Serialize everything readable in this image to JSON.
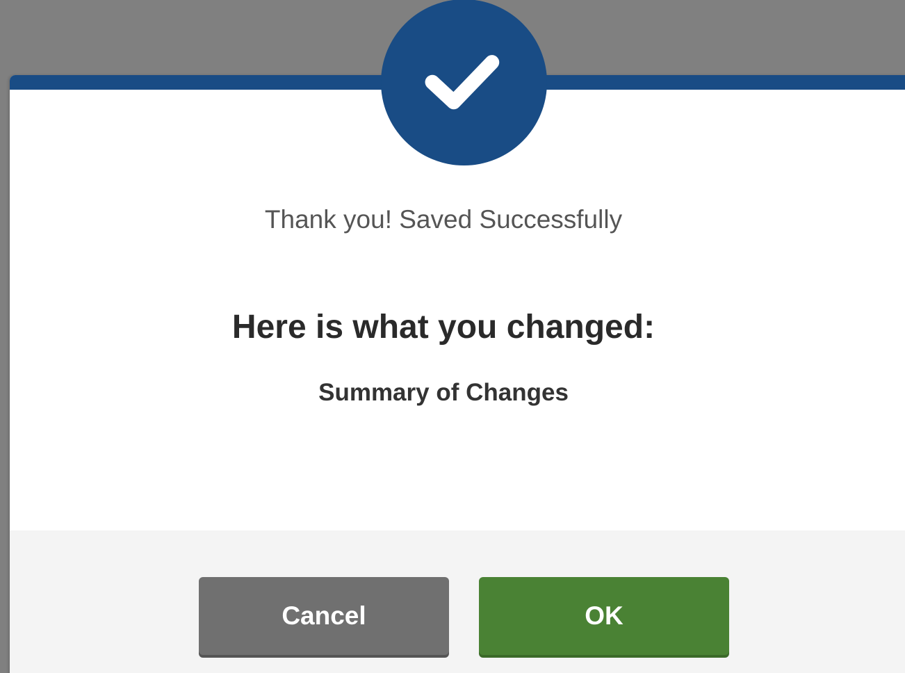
{
  "dialog": {
    "message": "Thank you! Saved Successfully",
    "heading": "Here is what you changed:",
    "summary": "Summary of Changes",
    "icon": "checkmark-icon"
  },
  "buttons": {
    "cancel_label": "Cancel",
    "ok_label": "OK"
  },
  "colors": {
    "primary": "#194c85",
    "ok_button": "#4a8234",
    "cancel_button": "#707070",
    "overlay": "#808080"
  }
}
